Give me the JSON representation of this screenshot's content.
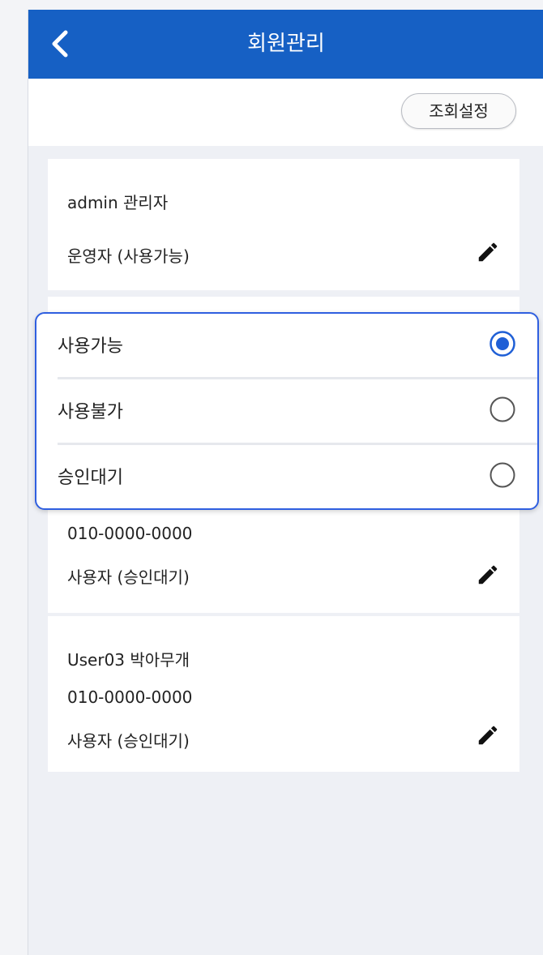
{
  "header": {
    "title": "회원관리"
  },
  "toolbar": {
    "query_settings_label": "조회설정"
  },
  "members": [
    {
      "name_line": "admin  관리자",
      "role_status": "운영자 (사용가능)"
    },
    {
      "phone": "010-0000-0000",
      "role_status": "사용자 (승인대기)"
    },
    {
      "name_line": "User03  박아무개",
      "phone": "010-0000-0000",
      "role_status": "사용자 (승인대기)"
    }
  ],
  "status_popup": {
    "options": [
      {
        "label": "사용가능",
        "selected": true
      },
      {
        "label": "사용불가",
        "selected": false
      },
      {
        "label": "승인대기",
        "selected": false
      }
    ]
  },
  "colors": {
    "header_bg": "#1660c4",
    "popup_border": "#2f5fe0",
    "radio_selected": "#1f5fd6"
  }
}
